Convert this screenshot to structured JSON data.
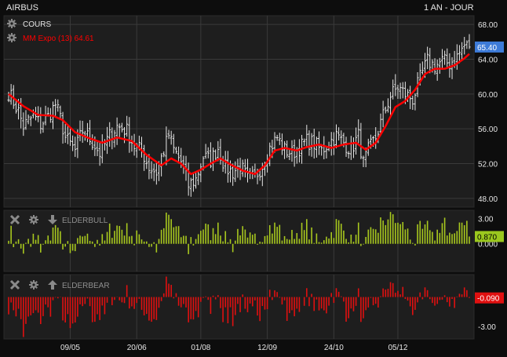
{
  "header": {
    "instrument": "AIRBUS",
    "period": "1 AN - JOUR"
  },
  "colors": {
    "background": "#0d0d0d",
    "panel": "#1e1e1e",
    "grid": "#3a3a3a",
    "price_bar": "#e8e8e8",
    "ema": "#ff0000",
    "bull": "#a8c81e",
    "bear": "#e01010",
    "price_tag": "#3d7bd8",
    "bull_tag": "#9bc81e",
    "bear_tag": "#e01010"
  },
  "legend": {
    "price_label": "COURS",
    "ema_label": "MM Expo (13)",
    "ema_value": "64.61",
    "bull_label": "ELDERBULL",
    "bear_label": "ELDERBEAR",
    "icons": [
      "gear-icon",
      "close-icon",
      "arrow-down-icon",
      "arrow-up-icon"
    ]
  },
  "tags": {
    "price": "65.40",
    "bull": "0.870",
    "bear": "-0.090"
  },
  "chart_data": [
    {
      "type": "ohlc",
      "title": "AIRBUS",
      "series": [
        {
          "name": "COURS",
          "close_path": [
            [
              0,
              60.2
            ],
            [
              4,
              58.0
            ],
            [
              6,
              56.3
            ],
            [
              10,
              57.5
            ],
            [
              13,
              56.5
            ],
            [
              16,
              57.4
            ],
            [
              19,
              58.8
            ],
            [
              21,
              57.2
            ],
            [
              23,
              55.0
            ],
            [
              27,
              53.5
            ],
            [
              30,
              55.8
            ],
            [
              34,
              54.5
            ],
            [
              37,
              53.2
            ],
            [
              41,
              55.2
            ],
            [
              44,
              56.3
            ],
            [
              48,
              55.8
            ],
            [
              51,
              54.0
            ],
            [
              54,
              53.5
            ],
            [
              57,
              51.6
            ],
            [
              60,
              51.0
            ],
            [
              63,
              53.5
            ],
            [
              65,
              55.3
            ],
            [
              67,
              53.6
            ],
            [
              70,
              52.2
            ],
            [
              73,
              49.5
            ],
            [
              76,
              50.2
            ],
            [
              79,
              52.8
            ],
            [
              82,
              52.4
            ],
            [
              85,
              53.8
            ],
            [
              88,
              51.5
            ],
            [
              91,
              51.0
            ],
            [
              94,
              51.8
            ],
            [
              97,
              50.2
            ],
            [
              100,
              50.5
            ],
            [
              103,
              51.8
            ],
            [
              106,
              53.8
            ],
            [
              109,
              55.0
            ],
            [
              112,
              53.6
            ],
            [
              115,
              53.2
            ],
            [
              118,
              53.8
            ],
            [
              121,
              54.6
            ],
            [
              124,
              54.3
            ],
            [
              127,
              53.5
            ],
            [
              130,
              54.4
            ],
            [
              133,
              55.2
            ],
            [
              136,
              54.4
            ],
            [
              139,
              53.6
            ],
            [
              142,
              55.2
            ],
            [
              144,
              52.0
            ],
            [
              146,
              53.5
            ],
            [
              149,
              55.0
            ],
            [
              152,
              57.5
            ],
            [
              155,
              59.8
            ],
            [
              158,
              60.8
            ],
            [
              161,
              60.0
            ],
            [
              164,
              59.4
            ],
            [
              167,
              61.8
            ],
            [
              170,
              63.8
            ],
            [
              173,
              63.2
            ],
            [
              176,
              63.8
            ],
            [
              179,
              63.5
            ],
            [
              182,
              64.3
            ],
            [
              185,
              65.6
            ],
            [
              187,
              65.4
            ]
          ]
        },
        {
          "name": "MM Expo (13)",
          "path": [
            [
              0,
              60.0
            ],
            [
              6,
              58.6
            ],
            [
              12,
              57.6
            ],
            [
              18,
              57.5
            ],
            [
              22,
              57.0
            ],
            [
              27,
              55.6
            ],
            [
              32,
              55.0
            ],
            [
              38,
              54.4
            ],
            [
              44,
              55.0
            ],
            [
              50,
              54.6
            ],
            [
              56,
              53.0
            ],
            [
              62,
              51.8
            ],
            [
              66,
              52.6
            ],
            [
              70,
              52.0
            ],
            [
              74,
              50.8
            ],
            [
              78,
              51.3
            ],
            [
              82,
              52.0
            ],
            [
              86,
              52.6
            ],
            [
              90,
              51.9
            ],
            [
              95,
              51.2
            ],
            [
              100,
              50.8
            ],
            [
              104,
              51.8
            ],
            [
              108,
              53.5
            ],
            [
              112,
              53.8
            ],
            [
              117,
              53.5
            ],
            [
              121,
              53.9
            ],
            [
              126,
              54.2
            ],
            [
              131,
              53.8
            ],
            [
              136,
              54.2
            ],
            [
              141,
              54.4
            ],
            [
              145,
              53.6
            ],
            [
              149,
              54.4
            ],
            [
              153,
              56.3
            ],
            [
              157,
              58.5
            ],
            [
              161,
              59.2
            ],
            [
              165,
              60.5
            ],
            [
              169,
              62.3
            ],
            [
              173,
              62.9
            ],
            [
              177,
              62.9
            ],
            [
              181,
              63.3
            ],
            [
              185,
              64.1
            ],
            [
              187,
              64.61
            ]
          ]
        }
      ],
      "ylim": [
        47,
        69
      ],
      "y_ticks": [
        "48.00",
        "52.00",
        "56.00",
        "60.00",
        "64.00",
        "68.00"
      ],
      "x_ticks": [
        {
          "label": "09/05",
          "index": 25
        },
        {
          "label": "20/06",
          "index": 52
        },
        {
          "label": "01/08",
          "index": 78
        },
        {
          "label": "12/09",
          "index": 105
        },
        {
          "label": "24/10",
          "index": 132
        },
        {
          "label": "05/12",
          "index": 158
        }
      ],
      "bars": 188,
      "last_value": 65.4,
      "ema_last": 64.61
    },
    {
      "type": "bar",
      "title": "ELDERBULL",
      "ylim": [
        -3.3,
        4.0
      ],
      "y_ticks": [
        "3.00",
        "0.000"
      ],
      "last_value": 0.87
    },
    {
      "type": "bar",
      "title": "ELDERBEAR",
      "ylim": [
        -4.3,
        2.3
      ],
      "y_ticks": [
        "-3.00"
      ],
      "last_value": -0.09
    }
  ]
}
